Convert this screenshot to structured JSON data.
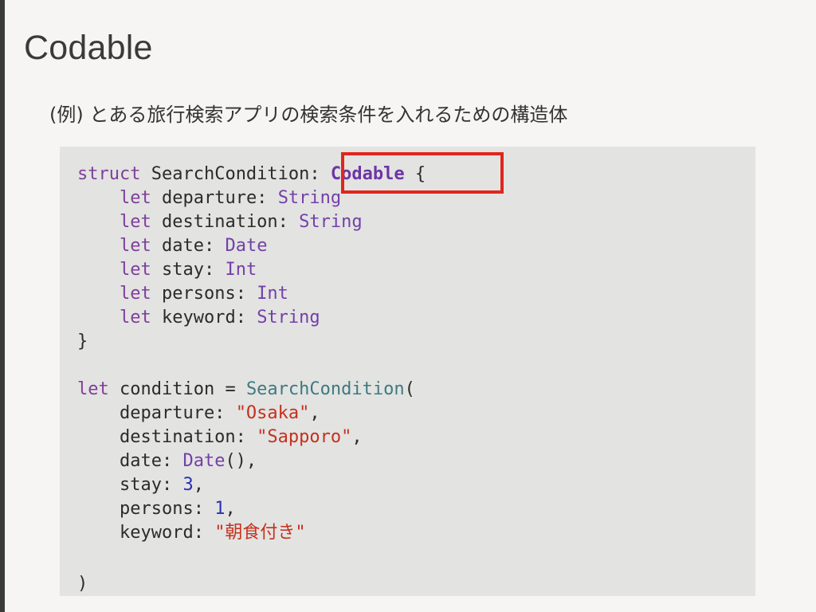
{
  "slide": {
    "title": "Codable",
    "subtitle": "(例) とある旅行検索アプリの検索条件を入れるための構造体"
  },
  "code": {
    "l1": {
      "kw": "struct",
      "name": " SearchConditio",
      "cursor_char": "n",
      "colon": ": ",
      "protocol": "Codable",
      "brace": " {"
    },
    "l2": {
      "indent": "    ",
      "kw": "let",
      "name": " departure: ",
      "type": "String"
    },
    "l3": {
      "indent": "    ",
      "kw": "let",
      "name": " destination: ",
      "type": "String"
    },
    "l4": {
      "indent": "    ",
      "kw": "let",
      "name": " date: ",
      "type": "Date"
    },
    "l5": {
      "indent": "    ",
      "kw": "let",
      "name": " stay: ",
      "type": "Int"
    },
    "l6": {
      "indent": "    ",
      "kw": "let",
      "name": " persons: ",
      "type": "Int"
    },
    "l7": {
      "indent": "    ",
      "kw": "let",
      "name": " keyword: ",
      "type": "String"
    },
    "l8": {
      "text": "}"
    },
    "l10": {
      "kw": "let",
      "name": " condition = ",
      "fn": "SearchCondition",
      "paren": "("
    },
    "l11": {
      "label": "    departure: ",
      "str": "\"Osaka\"",
      "comma": ","
    },
    "l12": {
      "label": "    destination: ",
      "str": "\"Sapporo\"",
      "comma": ","
    },
    "l13": {
      "label": "    date: ",
      "type": "Date",
      "rest": "(),"
    },
    "l14": {
      "label": "    stay: ",
      "num": "3",
      "comma": ","
    },
    "l15": {
      "label": "    persons: ",
      "num": "1",
      "comma": ","
    },
    "l16": {
      "label": "    keyword: ",
      "str": "\"朝食付き\""
    },
    "l18": {
      "text": ")"
    }
  },
  "colors": {
    "highlight_border": "#e0261c",
    "keyword": "#7e3f9a",
    "string": "#c4311d",
    "number": "#2b2fb5",
    "function": "#3d7a80"
  }
}
